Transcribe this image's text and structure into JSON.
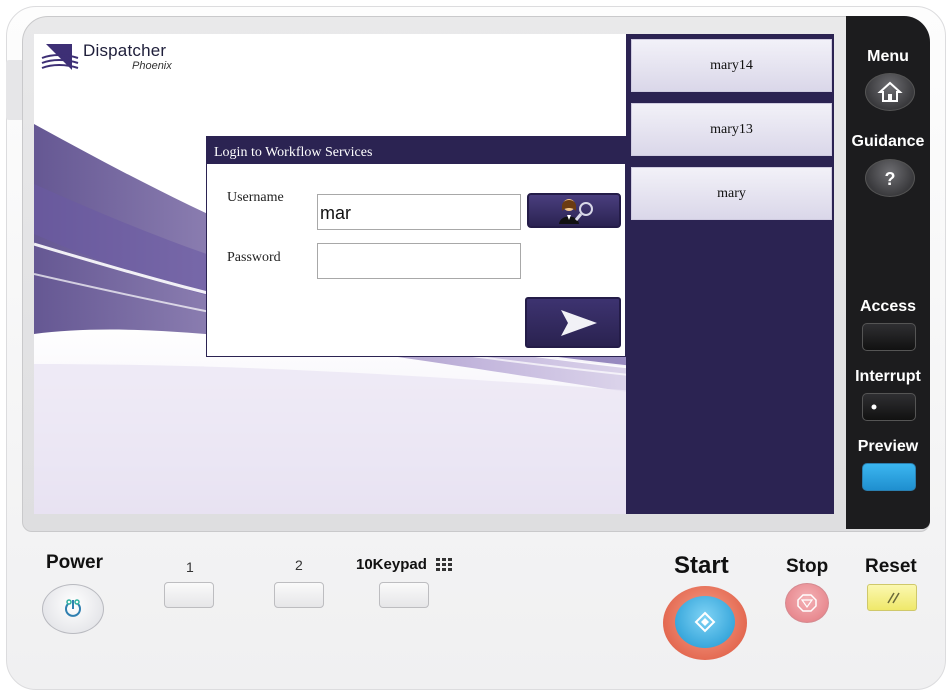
{
  "app": {
    "logo_title": "Dispatcher",
    "logo_subtitle": "Phoenix"
  },
  "dialog": {
    "title": "Login to Workflow Services",
    "username_label": "Username",
    "username_value": "mar",
    "password_label": "Password",
    "password_value": "",
    "lookup_icon": "user-search-icon",
    "submit_icon": "arrow-right-icon"
  },
  "user_list": [
    {
      "name": "mary14"
    },
    {
      "name": "mary13"
    },
    {
      "name": "mary"
    }
  ],
  "device_controls": {
    "menu_label": "Menu",
    "menu_icon": "home-icon",
    "guidance_label": "Guidance",
    "guidance_icon": "question-icon",
    "access_label": "Access",
    "interrupt_label": "Interrupt",
    "preview_label": "Preview"
  },
  "bottom_controls": {
    "power_label": "Power",
    "key1_label": "1",
    "key2_label": "2",
    "keypad_label": "10Keypad",
    "start_label": "Start",
    "stop_label": "Stop",
    "reset_label": "Reset"
  },
  "colors": {
    "brand_purple": "#2b2352",
    "start_blue": "#3aa8dc",
    "start_ring": "#e46a52",
    "stop_red": "#e88a90",
    "reset_yellow": "#f4f08a",
    "preview_blue": "#2ba6e8"
  }
}
